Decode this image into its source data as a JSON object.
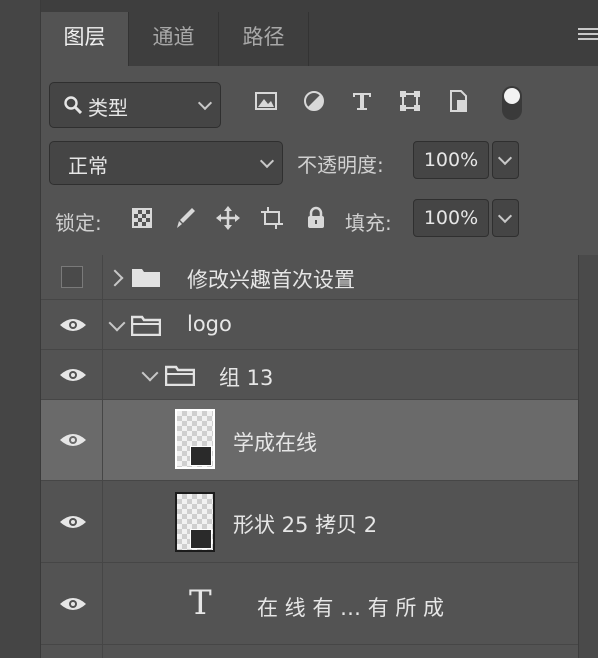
{
  "tabs": {
    "layers": "图层",
    "channels": "通道",
    "paths": "路径"
  },
  "filter": {
    "selected": "类型"
  },
  "filter_icons": [
    "image-icon",
    "adjustment-icon",
    "type-icon",
    "shape-icon",
    "smart-object-icon",
    "filter-toggle-icon"
  ],
  "blend": {
    "mode": "正常",
    "opacity_label": "不透明度:",
    "opacity_value": "100%"
  },
  "lock": {
    "label": "锁定:",
    "fill_label": "填充:",
    "fill_value": "100%"
  },
  "lock_icons": [
    "lock-transparent-pixels-icon",
    "lock-image-pixels-icon",
    "lock-position-icon",
    "lock-artboard-icon",
    "lock-all-icon"
  ],
  "layers": [
    {
      "name": "修改兴趣首次设置",
      "type": "group",
      "visible": false,
      "expanded": false,
      "selected": false,
      "indent": 0
    },
    {
      "name": "logo",
      "type": "group",
      "visible": true,
      "expanded": true,
      "selected": false,
      "indent": 0
    },
    {
      "name": "组 13",
      "type": "group",
      "visible": true,
      "expanded": true,
      "selected": false,
      "indent": 1
    },
    {
      "name": "学成在线",
      "type": "shape",
      "visible": true,
      "selected": true,
      "indent": 2
    },
    {
      "name": "形状 25 拷贝 2",
      "type": "shape",
      "visible": true,
      "selected": false,
      "indent": 2
    },
    {
      "name": "在 线 有 … 有 所 成",
      "type": "text",
      "visible": true,
      "selected": false,
      "indent": 2
    }
  ],
  "colors": {
    "panel_bg": "#535353",
    "tabbar_bg": "#3e3e3e",
    "selected_row": "#6a6a6a",
    "text": "#e6e6e6"
  }
}
